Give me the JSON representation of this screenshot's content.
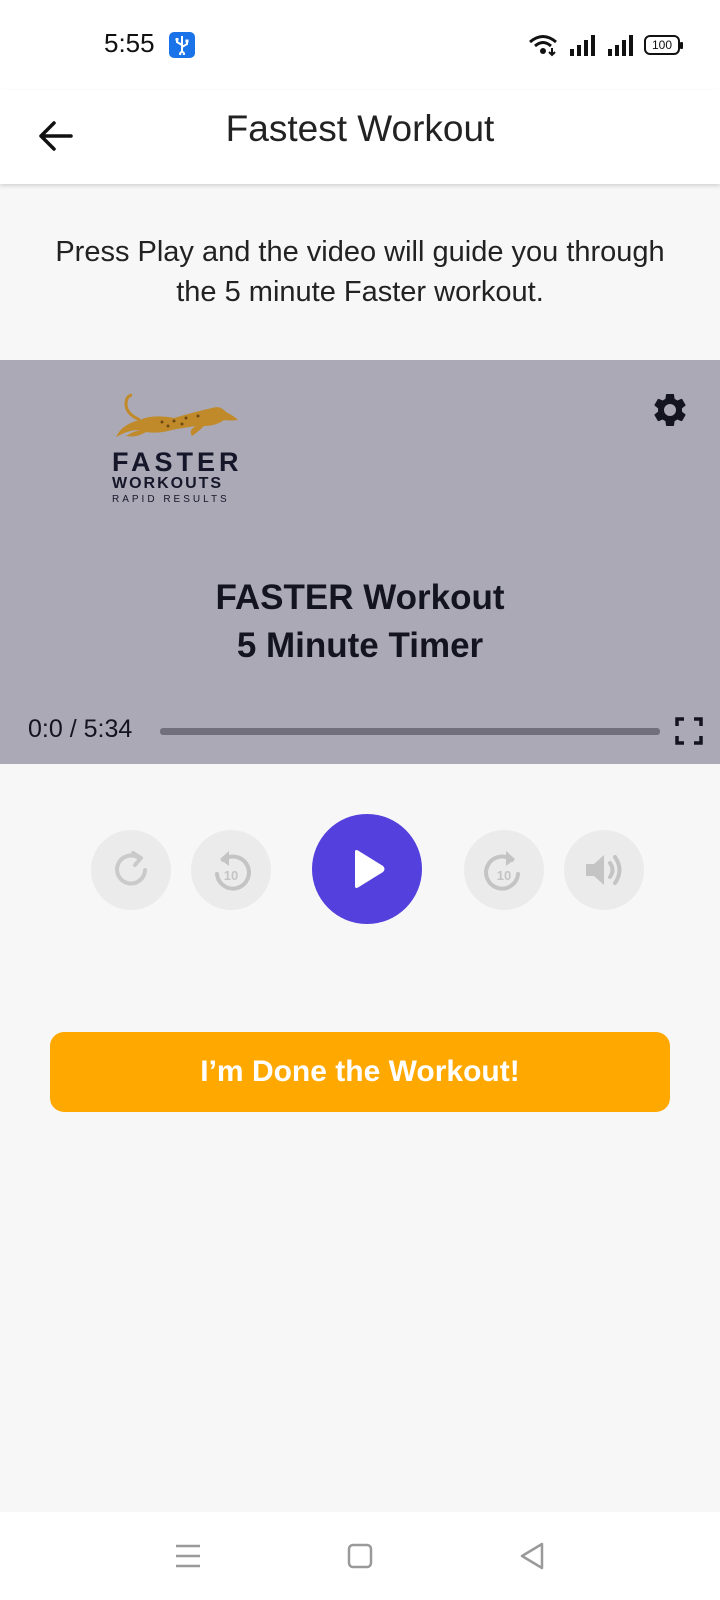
{
  "status_bar": {
    "time": "5:55",
    "battery": "100",
    "icons": [
      "usb-icon",
      "wifi-icon",
      "signal-icon",
      "signal-icon",
      "battery-icon"
    ]
  },
  "app_bar": {
    "title": "Fastest Workout",
    "back_icon": "arrow-left-icon"
  },
  "intro_text": "Press Play and the video will guide you through the 5 minute Faster workout.",
  "video": {
    "logo": {
      "line1": "FASTER",
      "line2": "WORKOUTS",
      "line3": "RAPID RESULTS"
    },
    "title_line1": "FASTER Workout",
    "title_line2": "5 Minute Timer",
    "time_readout": "0:0 / 5:34",
    "progress_fraction": 0,
    "background_color": "#aba9b5"
  },
  "controls": {
    "icons": [
      "restart-icon",
      "rewind-10-icon",
      "play-icon",
      "forward-10-icon",
      "volume-icon"
    ],
    "rewind_seconds": "10",
    "forward_seconds": "10",
    "accent_color": "#5440dc"
  },
  "done_button": {
    "label": "I’m Done the Workout!",
    "color": "#ffa800"
  },
  "nav_bar": {
    "icons": [
      "menu-icon",
      "home-icon",
      "back-icon"
    ]
  }
}
